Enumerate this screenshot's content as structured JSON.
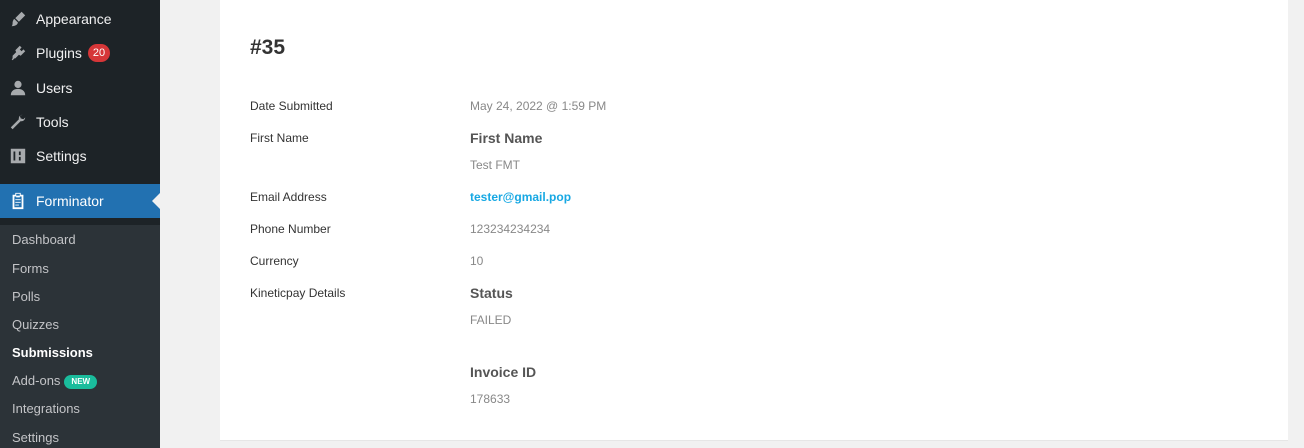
{
  "sidebar": {
    "items": [
      {
        "label": "Appearance",
        "icon": "paintbrush-icon"
      },
      {
        "label": "Plugins",
        "icon": "plugin-icon",
        "badge": "20"
      },
      {
        "label": "Users",
        "icon": "user-icon"
      },
      {
        "label": "Tools",
        "icon": "wrench-icon"
      },
      {
        "label": "Settings",
        "icon": "settings-icon"
      }
    ],
    "active": {
      "label": "Forminator",
      "icon": "clipboard-icon"
    },
    "submenu": [
      {
        "label": "Dashboard"
      },
      {
        "label": "Forms"
      },
      {
        "label": "Polls"
      },
      {
        "label": "Quizzes"
      },
      {
        "label": "Submissions"
      },
      {
        "label": "Add-ons",
        "badge": "NEW"
      },
      {
        "label": "Integrations"
      },
      {
        "label": "Settings"
      }
    ]
  },
  "entry": {
    "title": "#35",
    "fields": [
      {
        "label": "Date Submitted",
        "value": "May 24, 2022 @ 1:59 PM"
      },
      {
        "label": "First Name",
        "sub_title": "First Name",
        "value": "Test FMT"
      },
      {
        "label": "Email Address",
        "value": "tester@gmail.pop"
      },
      {
        "label": "Phone Number",
        "value": "123234234234"
      },
      {
        "label": "Currency",
        "value": "10"
      },
      {
        "label": "Kineticpay Details",
        "status_title": "Status",
        "status_value": "FAILED",
        "invoice_title": "Invoice ID",
        "invoice_value": "178633"
      }
    ]
  },
  "colors": {
    "sidebar": "#1d2327",
    "submenu": "#2c3338",
    "active": "#2271b1",
    "badge": "#d63638",
    "link": "#17a8e3",
    "new_badge": "#1abc9c"
  }
}
